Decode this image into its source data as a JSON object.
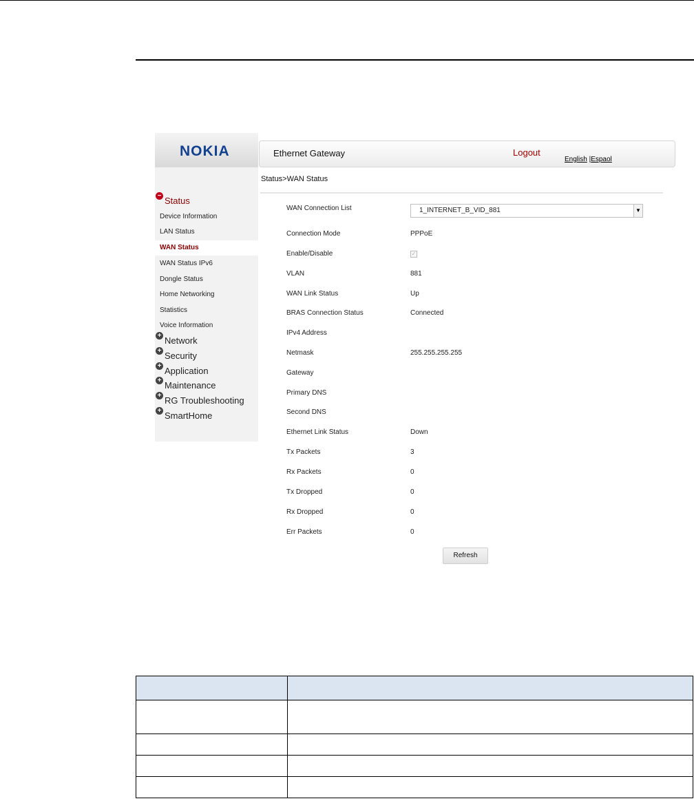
{
  "logo": "NOKIA",
  "header": {
    "title": "Ethernet Gateway",
    "logout": "Logout",
    "lang_english": "English",
    "lang_sep": " |",
    "lang_espanol": "Espaol"
  },
  "breadcrumb": "Status>WAN Status",
  "sidebar": {
    "status_label": "Status",
    "items": [
      "Device Information",
      "LAN Status",
      "WAN Status",
      "WAN Status IPv6",
      "Dongle Status",
      "Home Networking",
      "Statistics",
      "Voice Information"
    ],
    "sections": [
      "Network",
      "Security",
      "Application",
      "Maintenance",
      "RG Troubleshooting",
      "SmartHome"
    ]
  },
  "wan": {
    "connection_list_label": "WAN Connection List",
    "connection_list_value": "1_INTERNET_B_VID_881",
    "fields": [
      {
        "label": "Connection Mode",
        "value": "PPPoE"
      },
      {
        "label": "Enable/Disable",
        "value": ""
      },
      {
        "label": "VLAN",
        "value": "881"
      },
      {
        "label": "WAN Link Status",
        "value": "Up"
      },
      {
        "label": "BRAS Connection Status",
        "value": "Connected"
      },
      {
        "label": "IPv4 Address",
        "value": ""
      },
      {
        "label": "Netmask",
        "value": "255.255.255.255"
      },
      {
        "label": "Gateway",
        "value": ""
      },
      {
        "label": "Primary DNS",
        "value": ""
      },
      {
        "label": "Second DNS",
        "value": ""
      },
      {
        "label": "Ethernet Link Status",
        "value": "Down"
      },
      {
        "label": "Tx Packets",
        "value": "3"
      },
      {
        "label": "Rx Packets",
        "value": "0"
      },
      {
        "label": "Tx Dropped",
        "value": "0"
      },
      {
        "label": "Rx Dropped",
        "value": "0"
      },
      {
        "label": "Err Packets",
        "value": "0"
      }
    ],
    "enable_checked": true,
    "refresh_label": "Refresh"
  },
  "colors": {
    "accent_red": "#8b0000",
    "logo_blue": "#124191",
    "table_header_bg": "#dbe5f1"
  }
}
